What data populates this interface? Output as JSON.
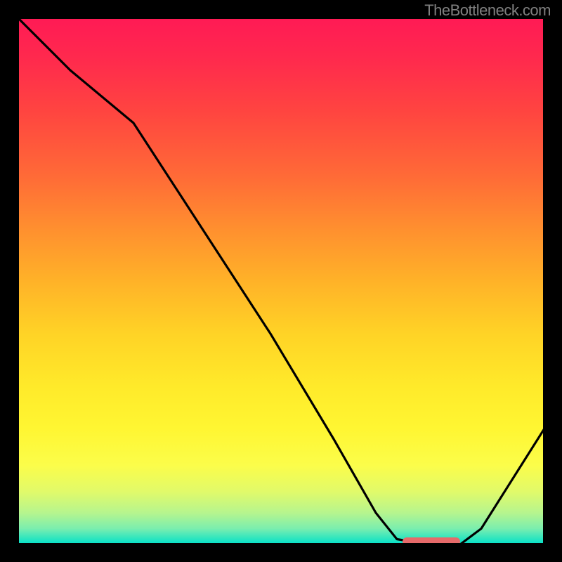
{
  "watermark": "TheBottleneck.com",
  "chart_data": {
    "type": "line",
    "title": "",
    "xlabel": "",
    "ylabel": "",
    "xlim": [
      0,
      100
    ],
    "ylim": [
      0,
      100
    ],
    "grid": false,
    "legend": false,
    "background": "red-yellow-green vertical gradient",
    "series": [
      {
        "name": "curve",
        "x": [
          0,
          10,
          22,
          35,
          48,
          60,
          68,
          72,
          78,
          84,
          88,
          100
        ],
        "y": [
          100,
          90,
          80,
          60,
          40,
          20,
          6,
          1,
          0,
          0,
          3,
          22
        ]
      }
    ],
    "marker": {
      "shape": "capsule",
      "color": "#e66a6a",
      "x_start": 73,
      "x_end": 84,
      "y": 0.6
    }
  }
}
